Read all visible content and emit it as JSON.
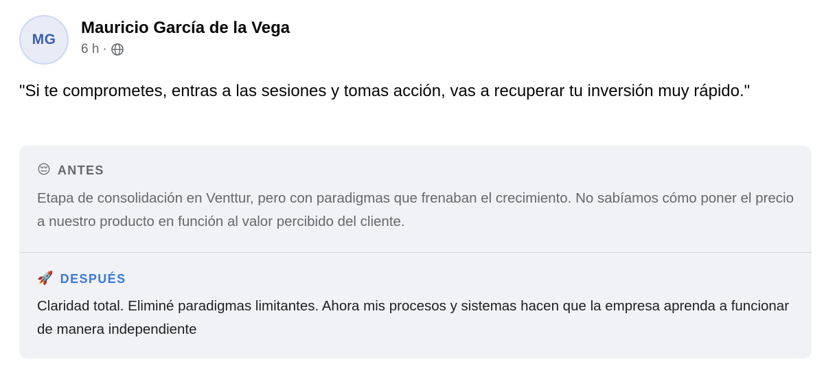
{
  "post": {
    "avatar_initials": "MG",
    "author": "Mauricio García de la Vega",
    "time": "6 h",
    "separator": "·",
    "privacy_icon": "globe-icon",
    "quote": "\"Si te comprometes, entras a las sesiones y tomas acción, vas a recuperar tu inversión muy rápido.\""
  },
  "before": {
    "emoji": "😔",
    "label": "ANTES",
    "text": "Etapa de consolidación en Venttur, pero con paradigmas que frenaban el crecimiento. No sabíamos cómo poner el precio a nuestro producto en función al valor percibido del cliente."
  },
  "after": {
    "emoji": "🚀",
    "label": "DESPUÉS",
    "text": "Claridad total. Eliminé paradigmas limitantes. Ahora mis procesos y sistemas hacen que la empresa aprenda a funcionar de manera independiente"
  },
  "colors": {
    "avatar_bg": "#e7ecf7",
    "avatar_text": "#3f5da8",
    "box_bg": "#f0f2f5",
    "after_label": "#3a78d9",
    "muted": "#65676b"
  }
}
